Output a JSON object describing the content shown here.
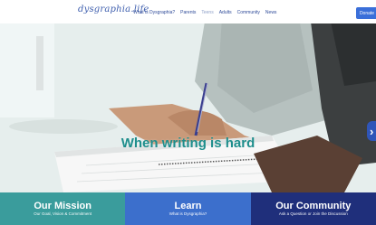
{
  "nav": {
    "logo": "dysgraphia.life",
    "links": [
      "What is Dysgraphia?",
      "Parents",
      "Teens",
      "Adults",
      "Community",
      "News"
    ],
    "donate_label": "Donate"
  },
  "hero": {
    "title": "When writing is hard",
    "arrow": "›"
  },
  "tiles": [
    {
      "title": "Our Mission",
      "subtitle": "Our Goal, Vision & Commitment",
      "color": "#3a9c9c"
    },
    {
      "title": "Learn",
      "subtitle": "What is Dysgraphia?",
      "color": "#3c6fcc"
    },
    {
      "title": "Our Community",
      "subtitle": "Ask a Question or Join the Discussion",
      "color": "#1f2f7b"
    }
  ],
  "colors": {
    "brand": "#3f5fae",
    "accent": "#1e8e8c"
  }
}
